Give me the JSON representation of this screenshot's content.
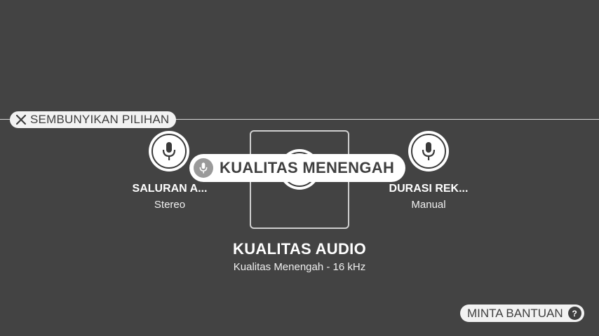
{
  "header": {
    "hide_options_label": "SEMBUNYIKAN PILIHAN"
  },
  "options": {
    "left": {
      "title": "SALURAN A...",
      "value": "Stereo",
      "icon": "mic-icon"
    },
    "center": {
      "title": "KUALITAS AUDIO",
      "value": "Kualitas Menengah - 16 kHz",
      "icon": "mic-icon"
    },
    "right": {
      "title": "DURASI REK...",
      "value": "Manual",
      "icon": "mic-icon"
    }
  },
  "tooltip": {
    "label": "KUALITAS MENENGAH",
    "icon": "mic-icon"
  },
  "footer": {
    "help_label": "MINTA BANTUAN",
    "help_icon_glyph": "?"
  },
  "colors": {
    "background": "#434343",
    "pill": "#f2f2f2",
    "text_dark": "#3f3f3f"
  }
}
